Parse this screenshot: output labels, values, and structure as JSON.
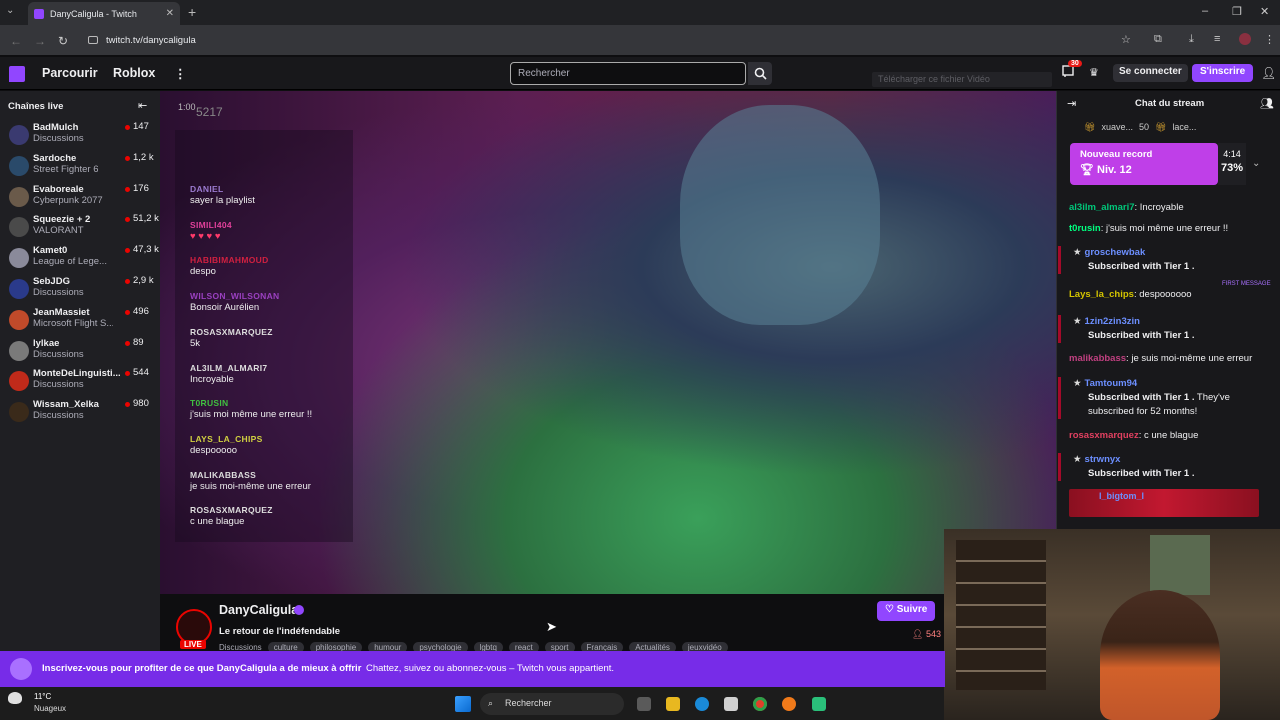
{
  "browser": {
    "tab_title": "DanyCaligula - Twitch",
    "url": "twitch.tv/danycaligula"
  },
  "topnav": {
    "browse": "Parcourir",
    "roblox": "Roblox",
    "search_placeholder": "Rechercher",
    "download_banner": "Télécharger ce fichier Vidéo",
    "notif_count": "30",
    "login": "Se connecter",
    "signup": "S'inscrire"
  },
  "sidebar": {
    "heading": "Chaînes live",
    "channels": [
      {
        "name": "BadMulch",
        "game": "Discussions",
        "viewers": "147",
        "color": "#3a3a70"
      },
      {
        "name": "Sardoche",
        "game": "Street Fighter 6",
        "viewers": "1,2 k",
        "color": "#2a4a6a"
      },
      {
        "name": "Evaboreale",
        "game": "Cyberpunk 2077",
        "viewers": "176",
        "color": "#6a5a4a"
      },
      {
        "name": "Squeezie + 2",
        "game": "VALORANT",
        "viewers": "51,2 k",
        "color": "#4a4a4a"
      },
      {
        "name": "Kamet0",
        "game": "League of Lege...",
        "viewers": "47,3 k",
        "color": "#8a8a9a"
      },
      {
        "name": "SebJDG",
        "game": "Discussions",
        "viewers": "2,9 k",
        "color": "#2a3a8a"
      },
      {
        "name": "JeanMassiet",
        "game": "Microsoft Flight S...",
        "viewers": "496",
        "color": "#c04a2a"
      },
      {
        "name": "lylkae",
        "game": "Discussions",
        "viewers": "89",
        "color": "#7a7a7a"
      },
      {
        "name": "MonteDeLinguisti...",
        "game": "Discussions",
        "viewers": "544",
        "color": "#c02a1a"
      },
      {
        "name": "Wissam_Xelka",
        "game": "Discussions",
        "viewers": "980",
        "color": "#3a2a1a"
      }
    ]
  },
  "video": {
    "timestamp": "1:00",
    "counter": "5217",
    "overlay_messages": [
      {
        "user": "DANIEL",
        "text": "sayer la playlist",
        "color": "#9b7bd0"
      },
      {
        "user": "SIMILI404",
        "text": "♥ ♥ ♥ ♥",
        "color": "#e0409a",
        "text_color": "#ff3a6a"
      },
      {
        "user": "HABIBIMAHMOUD",
        "text": "despo",
        "color": "#d02040"
      },
      {
        "user": "WILSON_WILSONAN",
        "text": "Bonsoir Aurélien",
        "color": "#9a40c0"
      },
      {
        "user": "ROSASXMARQUEZ",
        "text": "5k",
        "color": "#dddddd"
      },
      {
        "user": "AL3ILM_ALMARI7",
        "text": "Incroyable",
        "color": "#dddddd"
      },
      {
        "user": "T0RUSIN",
        "text": "j'suis moi même une erreur !!",
        "color": "#40c040"
      },
      {
        "user": "LAYS_LA_CHIPS",
        "text": "despooooo",
        "color": "#d0d040"
      },
      {
        "user": "MALIKABBASS",
        "text": "je suis moi-même une erreur",
        "color": "#dddddd"
      },
      {
        "user": "ROSASXMARQUEZ",
        "text": "c une blague",
        "color": "#dddddd"
      }
    ]
  },
  "stream_info": {
    "channel": "DanyCaligula",
    "live": "LIVE",
    "title": "Le retour de l'indéfendable",
    "category": "Discussions",
    "tags": [
      "culture",
      "philosophie",
      "humour",
      "psychologie",
      "lgbtq",
      "react",
      "sport",
      "Français",
      "Actualités",
      "jeuxvidéo"
    ],
    "follow": "Suivre",
    "viewers": "543"
  },
  "chat": {
    "title": "Chat du stream",
    "gift_bar": [
      {
        "name": "xuave...",
        "count": "50"
      },
      {
        "name": "lace...",
        "count": ""
      }
    ],
    "record_title": "Nouveau record",
    "record_level": "Niv. 12",
    "record_time": "4:14",
    "record_percent": "73%",
    "record_progress": 0.73,
    "first_message_badge": "FIRST MESSAGE",
    "messages": [
      {
        "type": "msg",
        "user": "al3ilm_almari7",
        "text": "Incroyable",
        "color": "#00c77a"
      },
      {
        "type": "msg",
        "user": "t0rusin",
        "text": "j'suis moi même une erreur !!",
        "color": "#00ff7f"
      },
      {
        "type": "sub",
        "user": "groschewbak",
        "text": "Subscribed with Tier 1 .",
        "extra": ""
      },
      {
        "type": "msg",
        "user": "Lays_la_chips",
        "text": "despoooooo",
        "color": "#d4c400"
      },
      {
        "type": "sub",
        "user": "1zin2zin3zin",
        "text": "Subscribed with Tier 1 .",
        "extra": ""
      },
      {
        "type": "msg",
        "user": "malikabbass",
        "text": "je suis moi-même une erreur",
        "color": "#c04080"
      },
      {
        "type": "sub",
        "user": "Tamtoum94",
        "text": "Subscribed with Tier 1 .",
        "extra": " They've subscribed for 52 months!"
      },
      {
        "type": "msg",
        "user": "rosasxmarquez",
        "text": "c une blague",
        "color": "#e04060"
      },
      {
        "type": "sub",
        "user": "strwnyx",
        "text": "Subscribed with Tier 1 .",
        "extra": ""
      }
    ],
    "last_user": "l_bigtom_l"
  },
  "subscribe_bar": {
    "main": "Inscrivez-vous pour profiter de ce que DanyCaligula a de mieux à offrir",
    "secondary": "Chattez, suivez ou abonnez-vous – Twitch vous appartient."
  },
  "taskbar": {
    "temperature": "11°C",
    "weather": "Nuageux",
    "search": "Rechercher"
  },
  "colors": {
    "twitch_purple": "#9146ff",
    "live_red": "#eb0400",
    "sub_bar": "#772ce8",
    "record": "#bf3fe8"
  }
}
